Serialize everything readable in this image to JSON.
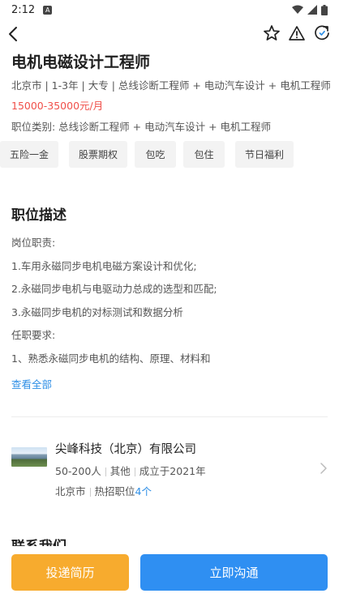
{
  "status_bar": {
    "time": "2:12",
    "notification_icon": "A"
  },
  "nav": {
    "icons": [
      "back-arrow-icon",
      "star-icon",
      "warning-icon",
      "refresh-icon"
    ]
  },
  "job": {
    "title": "电机电磁设计工程师",
    "meta": "北京市 | 1-3年 | 大专 | 总线诊断工程师 + 电动汽车设计 + 电机工程师",
    "salary": "15000-35000元/月",
    "category": "职位类别:   总线诊断工程师 + 电动汽车设计 + 电机工程师",
    "tags": [
      "五险一金",
      "股票期权",
      "包吃",
      "包住",
      "节日福利"
    ]
  },
  "description": {
    "title": "职位描述",
    "lines": [
      "岗位职责:",
      "1.车用永磁同步电机电磁方案设计和优化;",
      "2.永磁同步电机与电驱动力总成的选型和匹配;",
      "3.永磁同步电机的对标测试和数据分析",
      "任职要求:",
      "1、熟悉永磁同步电机的结构、原理、材料和"
    ],
    "view_all": "查看全部"
  },
  "company": {
    "name": "尖峰科技（北京）有限公司",
    "size": "50-200人",
    "industry": "其他",
    "founded": "成立于2021年",
    "city": "北京市",
    "hot_jobs_label": "热招职位",
    "hot_jobs_count": "4个"
  },
  "contact": {
    "title": "联系我们"
  },
  "actions": {
    "resume": "投递简历",
    "chat": "立即沟通"
  },
  "colors": {
    "salary": "#f0504a",
    "link": "#2f8fe6",
    "resume_button": "#f7ab2e",
    "chat_button": "#2f8ff2"
  }
}
